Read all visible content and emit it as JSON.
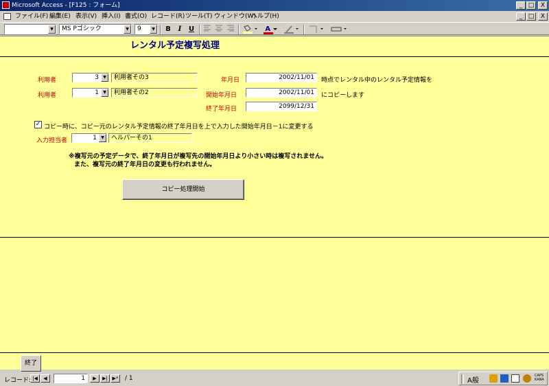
{
  "window": {
    "title": "Microsoft Access - [F125 : フォーム]",
    "buttons": [
      "_",
      "□",
      "X"
    ],
    "mdi_buttons": [
      "_",
      "□",
      "X"
    ]
  },
  "menu": [
    "ファイル(F)",
    "編集(E)",
    "表示(V)",
    "挿入(I)",
    "書式(O)",
    "レコード(R)",
    "ツール(T)",
    "ウィンドウ(W)",
    "ヘルプ(H)"
  ],
  "toolbar": {
    "object_combo": "",
    "font_name": "MS Pゴシック",
    "font_size": "9",
    "bold": "B",
    "italic": "I",
    "underline": "U",
    "fill_icon": "paint-bucket-icon",
    "fontcolor_glyph": "A",
    "line_glyph": "⁄"
  },
  "form": {
    "title": "レンタル予定複写処理",
    "row1": {
      "label": "利用者",
      "code": "3",
      "name": "利用者その3",
      "date_label": "年月日",
      "date": "2002/11/01",
      "suffix": "時点でレンタル中のレンタル予定情報を"
    },
    "row2": {
      "label": "利用者",
      "code": "1",
      "name": "利用者その2",
      "start_label": "開始年月日",
      "start_date": "2002/11/01",
      "suffix": "にコピーします",
      "end_label": "終了年月日",
      "end_date": "2099/12/31"
    },
    "checkbox": {
      "checked": true,
      "label": "コピー時に、コピー元のレンタル予定情報の終了年月日を上で入力した開始年月日－1に変更する"
    },
    "staff": {
      "label": "入力担当者",
      "code": "1",
      "name": "ヘルパーその1"
    },
    "note1": "※複写元の予定データで、終了年月日が複写先の開始年月日より小さい時は複写されません。",
    "note2": "また、複写元の終了年月日の変更も行われません。",
    "copy_button": "コピー処理開始",
    "end_button": "終了"
  },
  "record_nav": {
    "label": "レコード:",
    "current": "1",
    "total": "/ 1"
  },
  "ime": {
    "mode": "A般",
    "caps": "CAPS",
    "kana": "KANA"
  }
}
